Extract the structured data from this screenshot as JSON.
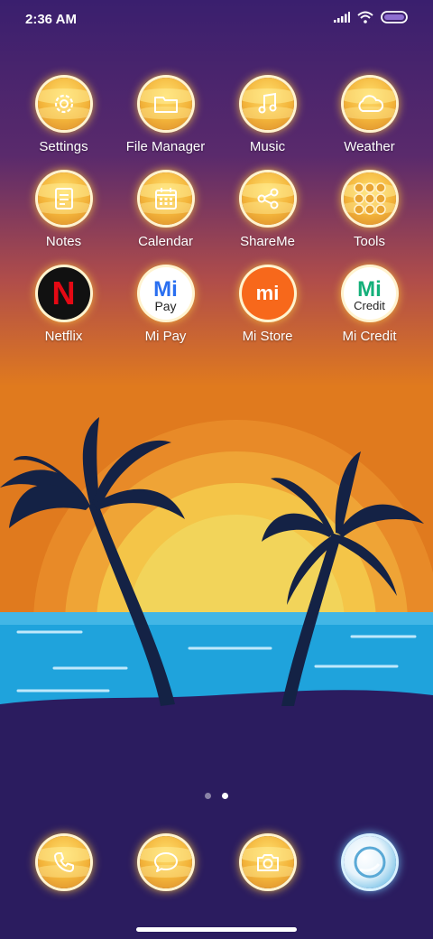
{
  "status_bar": {
    "time": "2:36 AM",
    "icons": [
      "signal-icon",
      "wifi-icon",
      "battery-icon"
    ]
  },
  "home_grid": {
    "apps": [
      {
        "label": "Settings",
        "icon": "gear-icon"
      },
      {
        "label": "File Manager",
        "icon": "folder-icon"
      },
      {
        "label": "Music",
        "icon": "music-note-icon"
      },
      {
        "label": "Weather",
        "icon": "cloud-icon"
      },
      {
        "label": "Notes",
        "icon": "note-icon"
      },
      {
        "label": "Calendar",
        "icon": "calendar-icon"
      },
      {
        "label": "ShareMe",
        "icon": "share-icon"
      },
      {
        "label": "Tools",
        "icon": "tools-folder-icon"
      },
      {
        "label": "Netflix",
        "icon": "netflix-icon",
        "glyph": "N"
      },
      {
        "label": "Mi Pay",
        "icon": "mi-pay-icon",
        "glyph": "Mi",
        "sub": "Pay"
      },
      {
        "label": "Mi Store",
        "icon": "mi-store-icon",
        "glyph": "mi"
      },
      {
        "label": "Mi Credit",
        "icon": "mi-credit-icon",
        "glyph": "Mi",
        "sub": "Credit"
      }
    ]
  },
  "pager": {
    "pages": 2,
    "current": 2
  },
  "dock": {
    "apps": [
      {
        "icon": "phone-icon"
      },
      {
        "icon": "messages-icon"
      },
      {
        "icon": "camera-icon"
      },
      {
        "icon": "browser-icon"
      }
    ]
  },
  "colors": {
    "sky_top": "#3a1f6e",
    "sky_mid": "#8a3d6a",
    "horizon": "#e07a1e",
    "sun": "#f2d45a",
    "sea": "#1fa3dc",
    "island": "#2b1c5f",
    "palm": "#142245",
    "icon_gold": "#f3b43a",
    "mi_store_orange": "#f7681b",
    "netflix_red": "#e50914"
  }
}
